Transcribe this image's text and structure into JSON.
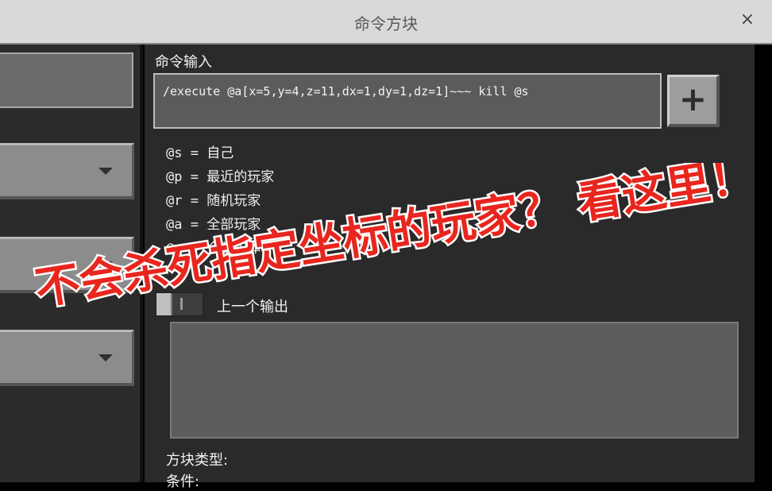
{
  "window": {
    "title": "命令方块",
    "close_glyph": "×"
  },
  "command": {
    "label": "命令输入",
    "value": "/execute @a[x=5,y=4,z=11,dx=1,dy=1,dz=1]~~~ kill @s",
    "add_glyph": "+"
  },
  "selectors": [
    {
      "key": "@s",
      "eq": " = ",
      "desc": "自己"
    },
    {
      "key": "@p",
      "eq": " = ",
      "desc": "最近的玩家"
    },
    {
      "key": "@r",
      "eq": " = ",
      "desc": "随机玩家"
    },
    {
      "key": "@a",
      "eq": " = ",
      "desc": "全部玩家"
    },
    {
      "key": "@e",
      "eq": " = ",
      "desc": "全部实体"
    }
  ],
  "previous_output": {
    "label": "上一个输出"
  },
  "block_info": {
    "type_label": "方块类型:",
    "condition_label": "条件:"
  },
  "overlay": {
    "text": "不会杀死指定坐标的玩家？ 看这里！",
    "color": "#e8261e"
  },
  "colors": {
    "background": "#2a2a2a",
    "titlebar": "#d9d9d9",
    "input": "#5b5b5b",
    "button": "#9d9d9d"
  }
}
